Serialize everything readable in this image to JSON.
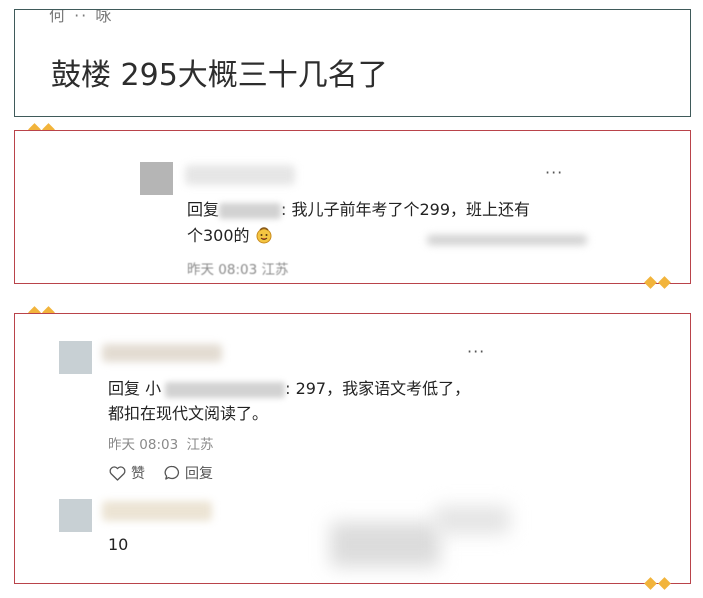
{
  "top_card": {
    "cut_text": "何 ·· 咏",
    "headline": "鼓楼 295大概三十几名了"
  },
  "comment1": {
    "more": "···",
    "reply_prefix": "回复",
    "reply_text_1": ": 我儿子前年考了个299，班上还有",
    "reply_text_2": "个300的",
    "emoji": "smiling-face-icon",
    "cut_meta": "昨天 08:03 江苏"
  },
  "comment2": {
    "more": "···",
    "reply_prefix": "回复 小",
    "reply_text_1": ": 297，我家语文考低了，",
    "reply_text_2": "都扣在现代文阅读了。",
    "time": "昨天 08:03",
    "location": "江苏",
    "like_label": "赞",
    "reply_label": "回复"
  },
  "comment3": {
    "text": "10"
  },
  "colors": {
    "frame_red": "#b9434a",
    "frame_dark": "#3f5a5a",
    "diamond": "#f2b43b"
  }
}
